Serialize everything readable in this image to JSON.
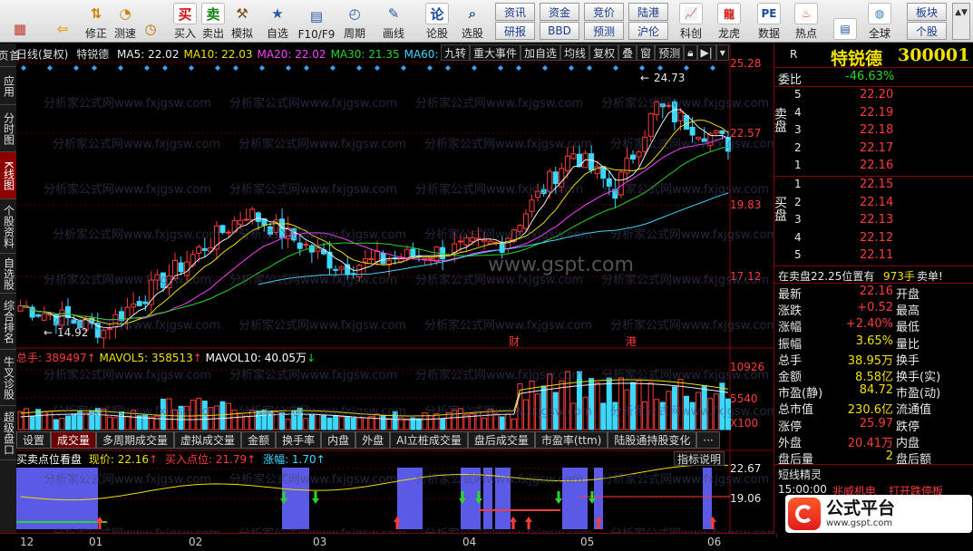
{
  "toolbar": {
    "buttons": [
      {
        "label": "",
        "icon": "grid-icon",
        "color": "#c0392b"
      },
      {
        "label": "",
        "icon": "back-arrow-icon",
        "color": "#e6a000"
      },
      {
        "label": "修正",
        "icon": "up-down-icon",
        "color": "#d08000"
      },
      {
        "label": "测速",
        "icon": "speedometer-icon",
        "color": "#d08000"
      },
      {
        "label": "",
        "icon": "clock-icon",
        "color": "#c07000"
      },
      {
        "label": "买入",
        "icon": "buy-icon",
        "glyph": "买",
        "color": "#d01010"
      },
      {
        "label": "卖出",
        "icon": "sell-icon",
        "glyph": "卖",
        "color": "#108010"
      },
      {
        "label": "模拟",
        "icon": "hammer-icon",
        "color": "#7a4a1a"
      },
      {
        "label": "自选",
        "icon": "folder-star-icon",
        "color": "#2a5aa0"
      },
      {
        "label": "F10/F9",
        "icon": "f10-icon",
        "color": "#2a5aa0"
      },
      {
        "label": "周期",
        "icon": "cycle-icon",
        "color": "#2a5aa0"
      },
      {
        "label": "画线",
        "icon": "pencil-icon",
        "color": "#2a5aa0"
      },
      {
        "label": "论股",
        "icon": "discuss-icon",
        "glyph": "论",
        "color": "#1a4a9a"
      },
      {
        "label": "选股",
        "icon": "magnifier-chart-icon",
        "color": "#2a5aa0"
      }
    ],
    "small_buttons": [
      {
        "label": "资讯"
      },
      {
        "label": "资金"
      },
      {
        "label": "竞价"
      },
      {
        "label": "陆港"
      },
      {
        "label": "研报"
      },
      {
        "label": "BBD"
      },
      {
        "label": "预测"
      },
      {
        "label": "沪伦"
      }
    ],
    "right_buttons": [
      {
        "label": "科创",
        "icon": "science-chart-icon"
      },
      {
        "label": "龙虎",
        "icon": "dragon-icon"
      },
      {
        "label": "数据",
        "icon": "pe-data-icon"
      },
      {
        "label": "热点",
        "icon": "fire-icon"
      },
      {
        "label": "",
        "icon": "document-icon"
      },
      {
        "label": "全球",
        "icon": "globe-icon"
      }
    ],
    "far_right": [
      {
        "label": "板块"
      },
      {
        "label": "个股"
      }
    ]
  },
  "leftnav": [
    {
      "label": "首页",
      "active": false
    },
    {
      "label": "应用",
      "active": false
    },
    {
      "label": "分时图",
      "active": false
    },
    {
      "label": "K线图",
      "active": true
    },
    {
      "label": "个股资料",
      "active": false
    },
    {
      "label": "自选股",
      "active": false
    },
    {
      "label": "综合排名",
      "active": false
    },
    {
      "label": "牛叉诊股",
      "active": false
    },
    {
      "label": "超级盘口",
      "active": false
    }
  ],
  "kline_header": {
    "period": "日线(复权)",
    "name": "特锐德",
    "ma": [
      {
        "label": "MA5: 22.02",
        "color": "#f0f0f0"
      },
      {
        "label": "MA10: 22.03",
        "color": "#f0e000"
      },
      {
        "label": "MA20: 22.02",
        "color": "#ff40ff"
      },
      {
        "label": "MA30: 21.35",
        "color": "#29d629"
      },
      {
        "label": "MA60:",
        "color": "#3dd8ff"
      }
    ],
    "tools": [
      "九转",
      "重大事件",
      "加自选",
      "均线",
      "复权",
      "叠",
      "窗",
      "预测"
    ]
  },
  "price_axis": [
    "25.28",
    "22.57",
    "19.83",
    "17.12"
  ],
  "price_annotations": {
    "high": "24.73",
    "low": "14.92",
    "marker1": "财",
    "marker2": "港"
  },
  "watermark": "分析家公式网www.fxjgsw.com",
  "site_watermark": "www.gspt.com",
  "volume_header": {
    "label": "总手: 389497",
    "mavol5": "MAVOL5: 358513",
    "mavol10": "MAVOL10: 40.05万"
  },
  "volume_axis": [
    "10926",
    "5540",
    "X100"
  ],
  "volume_tabs": [
    {
      "label": "设置",
      "active": false
    },
    {
      "label": "成交量",
      "active": true
    },
    {
      "label": "多周期成交量",
      "active": false
    },
    {
      "label": "虚拟成交量",
      "active": false
    },
    {
      "label": "金额",
      "active": false
    },
    {
      "label": "换手率",
      "active": false
    },
    {
      "label": "内盘",
      "active": false
    },
    {
      "label": "外盘",
      "active": false
    },
    {
      "label": "AI立桩成交量",
      "active": false
    },
    {
      "label": "盘后成交量",
      "active": false
    },
    {
      "label": "市盈率(ttm)",
      "active": false
    },
    {
      "label": "陆股通持股变化",
      "active": false
    },
    {
      "label": "···",
      "active": false
    }
  ],
  "indicator": {
    "title": "买卖点位看盘",
    "price": "现价: 22.16",
    "buy": "买入点位: 21.79",
    "change": "涨幅: 1.70",
    "button": "指标说明",
    "axis": [
      "22.67",
      "19.06"
    ]
  },
  "date_axis": [
    "12",
    "01",
    "02",
    "03",
    "04",
    "05",
    "06"
  ],
  "stock": {
    "name": "特锐德",
    "code": "300001",
    "r": "R"
  },
  "order_book": {
    "weibi_label": "委比",
    "weibi": "-46.63%",
    "sell_label": "卖盘",
    "buy_label": "买盘",
    "sell": [
      {
        "level": "5",
        "price": "22.20"
      },
      {
        "level": "4",
        "price": "22.19"
      },
      {
        "level": "3",
        "price": "22.18"
      },
      {
        "level": "2",
        "price": "22.17"
      },
      {
        "level": "1",
        "price": "22.16"
      }
    ],
    "buy": [
      {
        "level": "1",
        "price": "22.15"
      },
      {
        "level": "2",
        "price": "22.14"
      },
      {
        "level": "3",
        "price": "22.13"
      },
      {
        "level": "4",
        "price": "22.12"
      },
      {
        "level": "5",
        "price": "22.11"
      }
    ],
    "note_prefix": "在卖盘22.25位置有",
    "note_amount": "973手",
    "note_suffix": "卖单!"
  },
  "quote": [
    {
      "l1": "最新",
      "v1": "22.16",
      "c1": "red",
      "l2": "开盘",
      "v2": ""
    },
    {
      "l1": "涨跌",
      "v1": "+0.52",
      "c1": "red",
      "l2": "最高",
      "v2": ""
    },
    {
      "l1": "涨幅",
      "v1": "+2.40%",
      "c1": "red",
      "l2": "最低",
      "v2": ""
    },
    {
      "l1": "振幅",
      "v1": "3.65%",
      "c1": "yellow",
      "l2": "量比",
      "v2": ""
    },
    {
      "l1": "总手",
      "v1": "38.95万",
      "c1": "yellow",
      "l2": "换手",
      "v2": ""
    },
    {
      "l1": "金额",
      "v1": "8.58亿",
      "c1": "yellow",
      "l2": "换手(实)",
      "v2": ""
    },
    {
      "l1": "市盈(静)",
      "v1": "84.72",
      "c1": "yellow",
      "l2": "市盈(动)",
      "v2": ""
    },
    {
      "l1": "总市值",
      "v1": "230.6亿",
      "c1": "yellow",
      "l2": "流通值",
      "v2": ""
    },
    {
      "l1": "涨停",
      "v1": "25.97",
      "c1": "red",
      "l2": "跌停",
      "v2": ""
    },
    {
      "l1": "外盘",
      "v1": "20.41万",
      "c1": "red",
      "l2": "内盘",
      "v2": ""
    },
    {
      "l1": "盘后量",
      "v1": "2",
      "c1": "yellow",
      "l2": "盘后额",
      "v2": ""
    }
  ],
  "short_elf": {
    "title": "短线精灵",
    "time": "15:00:00",
    "stock": "兆威机电",
    "event": "打开跌停板"
  },
  "logo": {
    "text": "公式平台",
    "url": "www.gspt.com"
  }
}
